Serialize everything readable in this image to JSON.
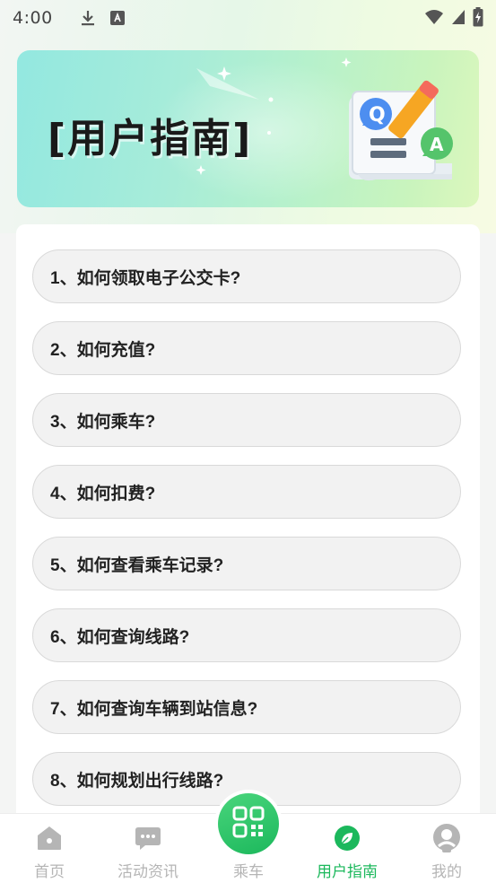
{
  "status_bar": {
    "time": "4:00"
  },
  "banner": {
    "title": "[用户指南]"
  },
  "faq": {
    "items": [
      "1、如何领取电子公交卡?",
      "2、如何充值?",
      "3、如何乘车?",
      "4、如何扣费?",
      "5、如何查看乘车记录?",
      "6、如何查询线路?",
      "7、如何查询车辆到站信息?",
      "8、如何规划出行线路?"
    ]
  },
  "tabbar": {
    "home": "首页",
    "activities": "活动资讯",
    "ride": "乘车",
    "guide": "用户指南",
    "mine": "我的"
  },
  "colors": {
    "accent": "#1cb85c",
    "inactive": "#b5b5b5"
  }
}
